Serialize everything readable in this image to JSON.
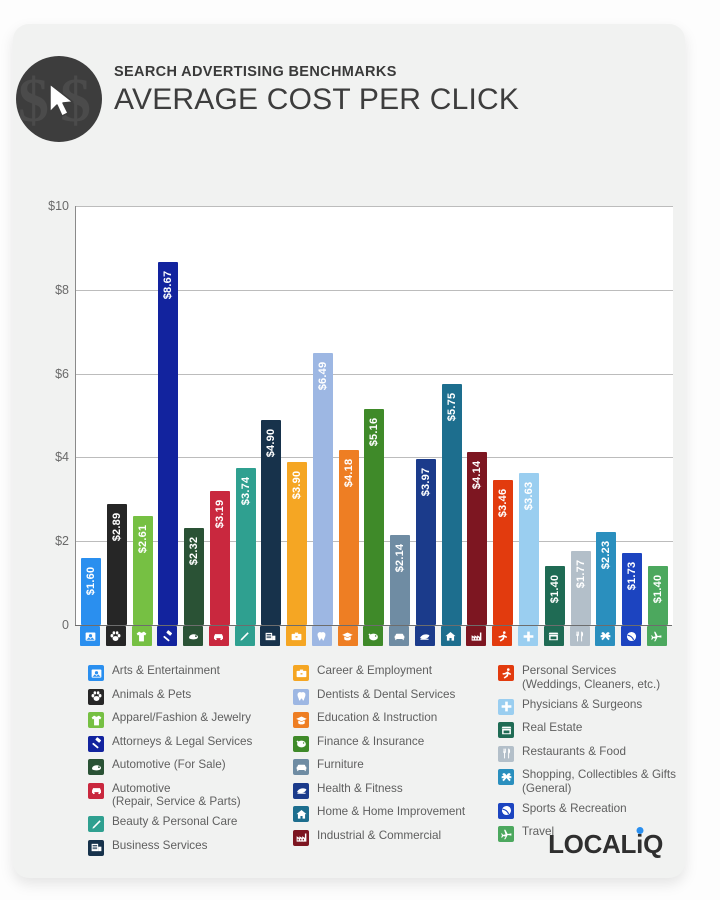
{
  "header": {
    "kicker": "SEARCH ADVERTISING BENCHMARKS",
    "title": "AVERAGE COST PER CLICK",
    "logo_icon": "dollar-cursor-icon"
  },
  "brand": {
    "text_before": "LOCAL",
    "text_i": "i",
    "text_after": "Q"
  },
  "chart_data": {
    "type": "bar",
    "title": "AVERAGE COST PER CLICK",
    "subtitle": "SEARCH ADVERTISING BENCHMARKS",
    "xlabel": "",
    "ylabel": "",
    "ylim": [
      0,
      10
    ],
    "grid": true,
    "legend_position": "bottom",
    "ytick_labels": [
      "$10",
      "$8",
      "$6",
      "$4",
      "$2",
      "0"
    ],
    "ytick_values": [
      10,
      8,
      6,
      4,
      2,
      0
    ],
    "categories": [
      "Arts & Entertainment",
      "Animals & Pets",
      "Apparel/Fashion & Jewelry",
      "Attorneys & Legal Services",
      "Automotive (For Sale)",
      "Automotive\n(Repair, Service & Parts)",
      "Beauty & Personal Care",
      "Business Services",
      "Career & Employment",
      "Dentists & Dental Services",
      "Education & Instruction",
      "Finance & Insurance",
      "Furniture",
      "Health & Fitness",
      "Home & Home Improvement",
      "Industrial & Commercial",
      "Personal Services\n(Weddings, Cleaners, etc.)",
      "Physicians & Surgeons",
      "Real Estate",
      "Restaurants & Food",
      "Shopping, Collectibles & Gifts\n(General)",
      "Sports & Recreation",
      "Travel"
    ],
    "values": [
      1.6,
      2.89,
      2.61,
      8.67,
      2.32,
      3.19,
      3.74,
      4.9,
      3.9,
      6.49,
      4.18,
      5.16,
      2.14,
      3.97,
      5.75,
      4.14,
      3.46,
      3.63,
      1.4,
      1.77,
      2.23,
      1.73,
      1.4
    ],
    "value_labels": [
      "$1.60",
      "$2.89",
      "$2.61",
      "$8.67",
      "$2.32",
      "$3.19",
      "$3.74",
      "$4.90",
      "$3.90",
      "$6.49",
      "$4.18",
      "$5.16",
      "$2.14",
      "$3.97",
      "$5.75",
      "$4.14",
      "$3.46",
      "$3.63",
      "$1.40",
      "$1.77",
      "$2.23",
      "$1.73",
      "$1.40"
    ],
    "colors": [
      "#2a8fef",
      "#262626",
      "#76c043",
      "#12239e",
      "#2a5235",
      "#c9283e",
      "#2fa090",
      "#17324b",
      "#f5a623",
      "#9db7e3",
      "#ee7e23",
      "#3f8a29",
      "#6f8ca3",
      "#1b3b8b",
      "#1d6e8e",
      "#7d1621",
      "#e23b0e",
      "#9acef0",
      "#1f6b54",
      "#b3bfc9",
      "#2a8fbe",
      "#1c44c0",
      "#4ca85e"
    ],
    "icons": [
      "picture-icon",
      "paw-icon",
      "tshirt-icon",
      "gavel-icon",
      "car-tag-icon",
      "car-icon",
      "nail-file-icon",
      "document-icon",
      "briefcase-icon",
      "tooth-icon",
      "graduation-cap-icon",
      "piggy-bank-icon",
      "sofa-icon",
      "dumbbell-icon",
      "house-icon",
      "factory-icon",
      "person-running-icon",
      "medical-cross-icon",
      "storefront-icon",
      "fork-knife-icon",
      "gift-bow-icon",
      "ball-icon",
      "airplane-icon"
    ]
  },
  "legend": {
    "columns": [
      {
        "items": [
          {
            "label": "Arts & Entertainment",
            "color": "#2a8fef",
            "icon": "picture-icon"
          },
          {
            "label": "Animals & Pets",
            "color": "#262626",
            "icon": "paw-icon"
          },
          {
            "label": "Apparel/Fashion & Jewelry",
            "color": "#76c043",
            "icon": "tshirt-icon"
          },
          {
            "label": "Attorneys & Legal Services",
            "color": "#12239e",
            "icon": "gavel-icon"
          },
          {
            "label": "Automotive (For Sale)",
            "color": "#2a5235",
            "icon": "car-tag-icon"
          },
          {
            "label": "Automotive\n(Repair, Service & Parts)",
            "color": "#c9283e",
            "icon": "car-icon"
          },
          {
            "label": "Beauty & Personal Care",
            "color": "#2fa090",
            "icon": "nail-file-icon"
          },
          {
            "label": "Business Services",
            "color": "#17324b",
            "icon": "document-icon"
          }
        ]
      },
      {
        "items": [
          {
            "label": "Career & Employment",
            "color": "#f5a623",
            "icon": "briefcase-icon"
          },
          {
            "label": "Dentists & Dental Services",
            "color": "#9db7e3",
            "icon": "tooth-icon"
          },
          {
            "label": "Education & Instruction",
            "color": "#ee7e23",
            "icon": "graduation-cap-icon"
          },
          {
            "label": "Finance & Insurance",
            "color": "#3f8a29",
            "icon": "piggy-bank-icon"
          },
          {
            "label": "Furniture",
            "color": "#6f8ca3",
            "icon": "sofa-icon"
          },
          {
            "label": "Health & Fitness",
            "color": "#1b3b8b",
            "icon": "dumbbell-icon"
          },
          {
            "label": "Home & Home Improvement",
            "color": "#1d6e8e",
            "icon": "house-icon"
          },
          {
            "label": "Industrial & Commercial",
            "color": "#7d1621",
            "icon": "factory-icon"
          }
        ]
      },
      {
        "items": [
          {
            "label": "Personal Services\n(Weddings, Cleaners, etc.)",
            "color": "#e23b0e",
            "icon": "person-running-icon"
          },
          {
            "label": "Physicians & Surgeons",
            "color": "#9acef0",
            "icon": "medical-cross-icon"
          },
          {
            "label": "Real Estate",
            "color": "#1f6b54",
            "icon": "storefront-icon"
          },
          {
            "label": "Restaurants & Food",
            "color": "#b3bfc9",
            "icon": "fork-knife-icon"
          },
          {
            "label": "Shopping, Collectibles & Gifts\n(General)",
            "color": "#2a8fbe",
            "icon": "gift-bow-icon"
          },
          {
            "label": "Sports & Recreation",
            "color": "#1c44c0",
            "icon": "ball-icon"
          },
          {
            "label": "Travel",
            "color": "#4ca85e",
            "icon": "airplane-icon"
          }
        ]
      }
    ]
  }
}
